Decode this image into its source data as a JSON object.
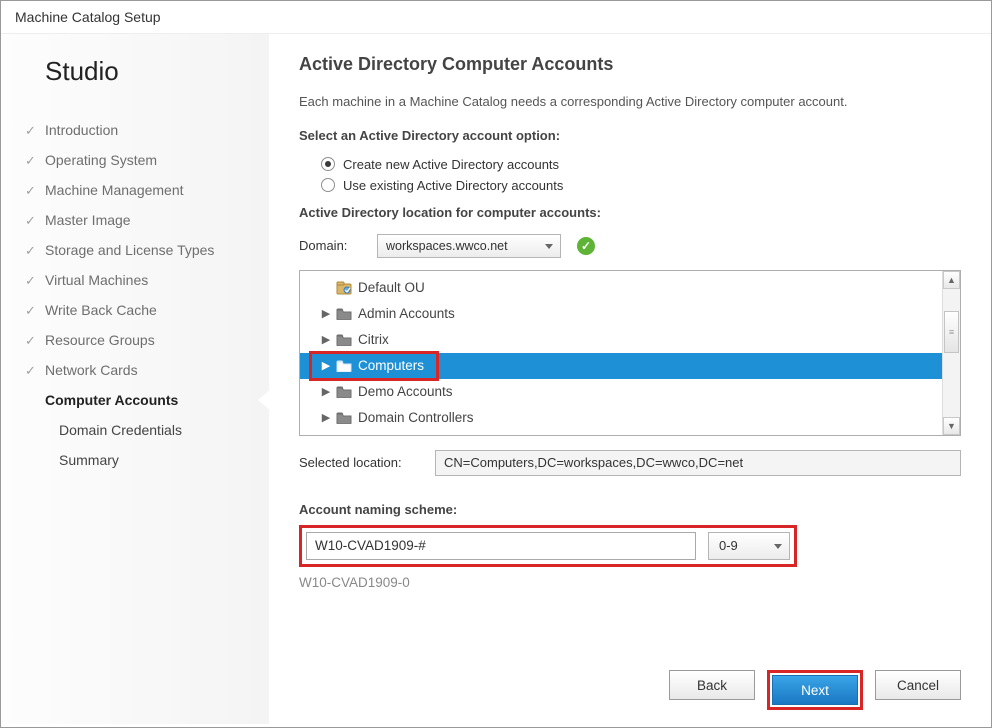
{
  "window": {
    "title": "Machine Catalog Setup"
  },
  "sidebar": {
    "heading": "Studio",
    "items": [
      {
        "label": "Introduction",
        "state": "completed"
      },
      {
        "label": "Operating System",
        "state": "completed"
      },
      {
        "label": "Machine Management",
        "state": "completed"
      },
      {
        "label": "Master Image",
        "state": "completed"
      },
      {
        "label": "Storage and License Types",
        "state": "completed"
      },
      {
        "label": "Virtual Machines",
        "state": "completed"
      },
      {
        "label": "Write Back Cache",
        "state": "completed"
      },
      {
        "label": "Resource Groups",
        "state": "completed"
      },
      {
        "label": "Network Cards",
        "state": "completed"
      },
      {
        "label": "Computer Accounts",
        "state": "current"
      },
      {
        "label": "Domain Credentials",
        "state": "future"
      },
      {
        "label": "Summary",
        "state": "future"
      }
    ]
  },
  "main": {
    "title": "Active Directory Computer Accounts",
    "intro": "Each machine in a Machine Catalog needs a corresponding Active Directory computer account.",
    "option_heading": "Select an Active Directory account option:",
    "radios": {
      "create": "Create new Active Directory accounts",
      "use_existing": "Use existing Active Directory accounts"
    },
    "location_heading": "Active Directory location for computer accounts:",
    "domain_label": "Domain:",
    "domain_value": "workspaces.wwco.net",
    "tree": [
      {
        "label": "Default OU",
        "kind": "ou",
        "expandable": false
      },
      {
        "label": "Admin Accounts",
        "kind": "folder",
        "expandable": true
      },
      {
        "label": "Citrix",
        "kind": "folder",
        "expandable": true
      },
      {
        "label": "Computers",
        "kind": "folder",
        "expandable": true,
        "selected": true
      },
      {
        "label": "Demo Accounts",
        "kind": "folder",
        "expandable": true
      },
      {
        "label": "Domain Controllers",
        "kind": "folder",
        "expandable": true
      }
    ],
    "selected_location_label": "Selected location:",
    "selected_location_value": "CN=Computers,DC=workspaces,DC=wwco,DC=net",
    "naming_label": "Account naming scheme:",
    "naming_value": "W10-CVAD1909-#",
    "naming_type": "0-9",
    "naming_preview": "W10-CVAD1909-0"
  },
  "buttons": {
    "back": "Back",
    "next": "Next",
    "cancel": "Cancel"
  }
}
